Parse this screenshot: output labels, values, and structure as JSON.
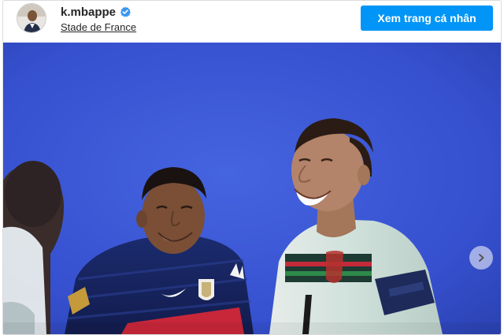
{
  "post": {
    "username": "k.mbappe",
    "verified": true,
    "location": "Stade de France",
    "profile_button_label": "Xem trang cá nhân"
  },
  "media": {
    "has_next": true
  },
  "colors": {
    "accent": "#0095f6",
    "verified_badge": "#3897f0",
    "photo_background": "#3a53d4"
  },
  "icons": {
    "verified": "verified-badge-icon",
    "next": "chevron-right-icon"
  }
}
